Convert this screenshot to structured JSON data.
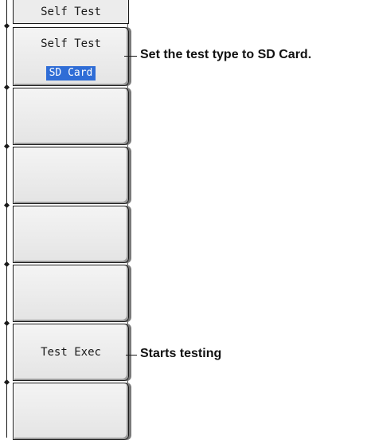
{
  "menu": {
    "title": "Self Test",
    "self_test_key": {
      "label": "Self Test",
      "value": "SD Card"
    },
    "exec_key": {
      "label": "Test Exec"
    }
  },
  "callouts": {
    "self_test": "Set the test type to SD Card.",
    "exec": "Starts testing"
  }
}
